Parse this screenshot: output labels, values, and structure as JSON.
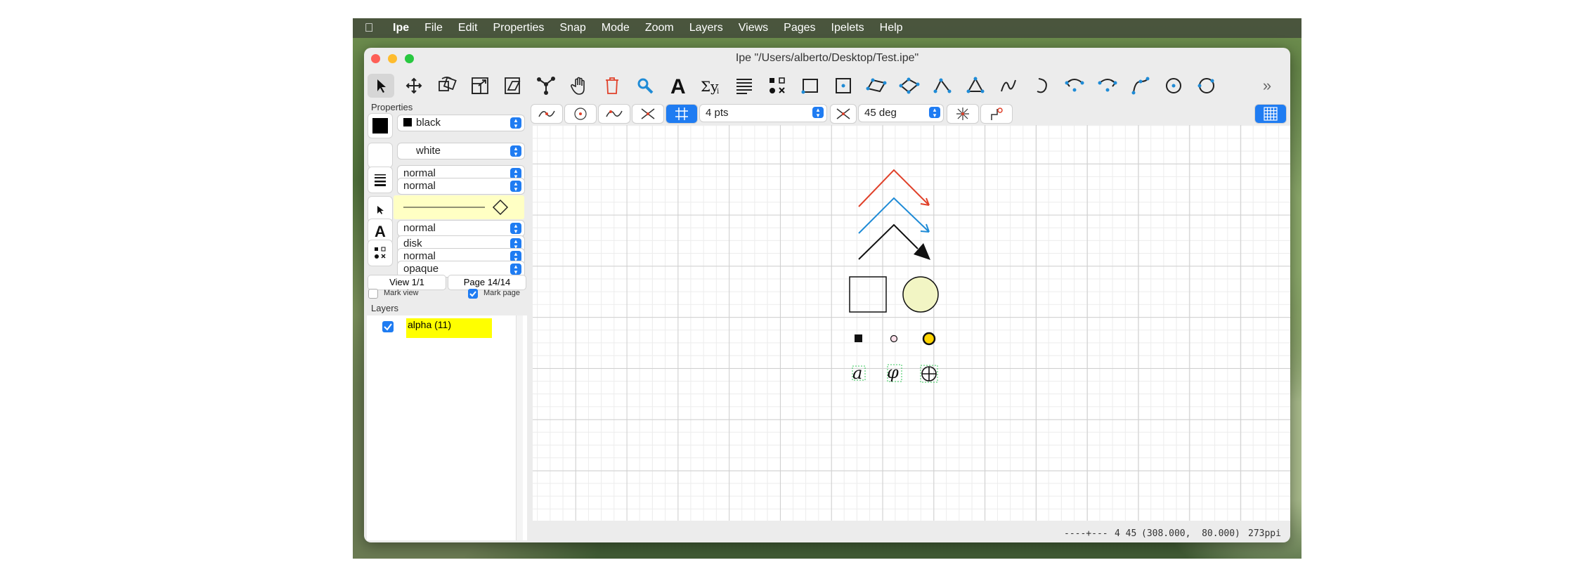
{
  "menubar": {
    "items": [
      "Ipe",
      "File",
      "Edit",
      "Properties",
      "Snap",
      "Mode",
      "Zoom",
      "Layers",
      "Views",
      "Pages",
      "Ipelets",
      "Help"
    ]
  },
  "window": {
    "title": "Ipe \"/Users/alberto/Desktop/Test.ipe\""
  },
  "toolbar": {
    "tools": [
      "select",
      "translate",
      "rotate",
      "stretch",
      "shear",
      "graph",
      "pan",
      "shredder",
      "magnifier",
      "text",
      "math",
      "paragraph",
      "marks",
      "rectangle",
      "box",
      "parallelogram",
      "polygon",
      "splinegon",
      "line",
      "spline",
      "arc",
      "curve",
      "circle-arc",
      "circle-arc-cw",
      "spline-curve",
      "circle",
      "circle-3pt"
    ],
    "more": "»"
  },
  "properties": {
    "heading": "Properties",
    "stroke": "black",
    "fill": "white",
    "pen": "normal",
    "dash": "normal",
    "textsize": "normal",
    "marks": "disk",
    "marksize": "normal",
    "opacity": "opaque",
    "view": "View 1/1",
    "page": "Page 14/14",
    "mark_view": "Mark view",
    "mark_page": "Mark page",
    "mark_view_checked": false,
    "mark_page_checked": true
  },
  "layers": {
    "heading": "Layers",
    "items": [
      {
        "name": "alpha (11)",
        "checked": true,
        "color": "#ffff00"
      }
    ]
  },
  "snap": {
    "gridsize": "4 pts",
    "angle": "45 deg",
    "grid_on": true
  },
  "status": {
    "dash_indicator": "----+---",
    "grid_info": "4 45",
    "coords": "(308.000,  80.000)",
    "resolution": "273ppi"
  },
  "colors": {
    "accent": "#1f7cf2",
    "arrow_red": "#e0412a",
    "arrow_blue": "#1f8bd6",
    "circle_fill": "#f2f5c4",
    "layer_highlight": "#ffff00",
    "yellow_mark": "#ffd400"
  },
  "canvas": {
    "labels": {
      "a": "a",
      "phi": "φ",
      "oplus": "⊕"
    }
  }
}
